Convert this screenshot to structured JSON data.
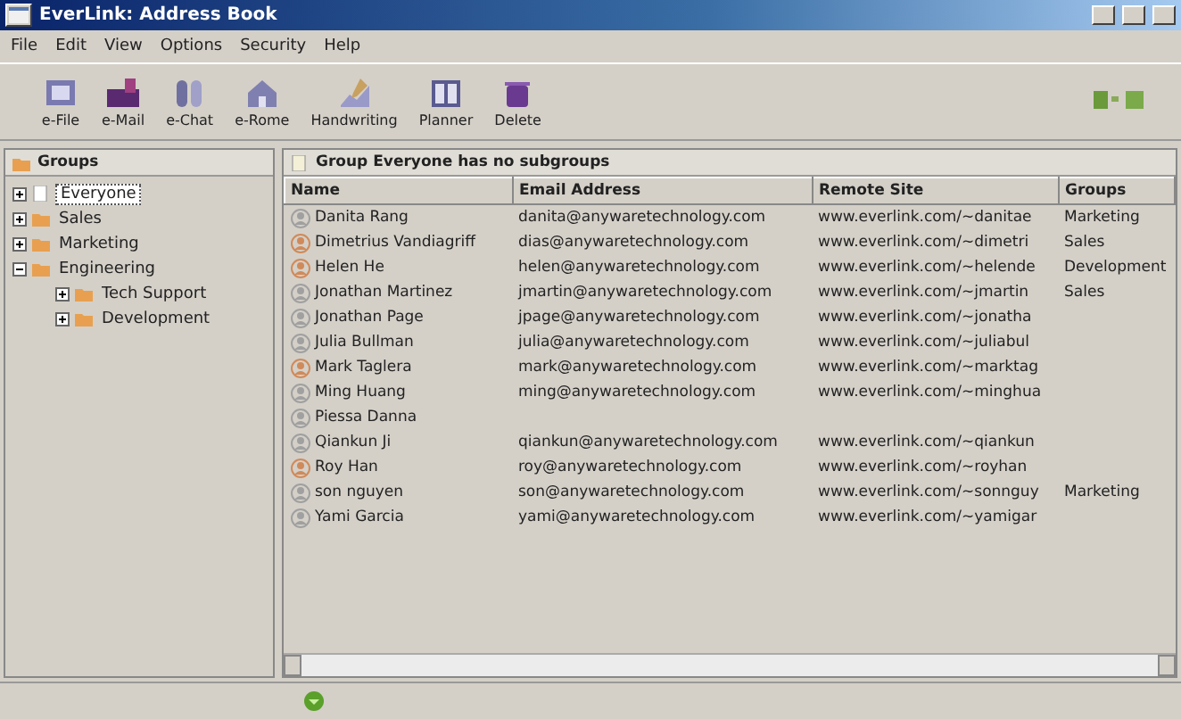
{
  "window": {
    "title": "EverLink: Address Book"
  },
  "menu": [
    "File",
    "Edit",
    "View",
    "Options",
    "Security",
    "Help"
  ],
  "toolbar": [
    {
      "label": "e-File",
      "kind": "file"
    },
    {
      "label": "e-Mail",
      "kind": "mail"
    },
    {
      "label": "e-Chat",
      "kind": "chat"
    },
    {
      "label": "e-Rome",
      "kind": "home"
    },
    {
      "label": "Handwriting",
      "kind": "pen"
    },
    {
      "label": "Planner",
      "kind": "planner"
    },
    {
      "label": "Delete",
      "kind": "trash"
    }
  ],
  "sidebar": {
    "title": "Groups",
    "items": [
      {
        "label": "Everyone",
        "selected": true,
        "expanded": false
      },
      {
        "label": "Sales",
        "selected": false,
        "expanded": false
      },
      {
        "label": "Marketing",
        "selected": false,
        "expanded": false
      },
      {
        "label": "Engineering",
        "selected": false,
        "expanded": true,
        "children": [
          {
            "label": "Tech Support",
            "selected": false,
            "expanded": false
          },
          {
            "label": "Development",
            "selected": false,
            "expanded": false
          }
        ]
      }
    ]
  },
  "table": {
    "caption": "Group Everyone has no subgroups",
    "columns": [
      "Name",
      "Email Address",
      "Remote Site",
      "Groups"
    ],
    "rows": [
      {
        "color": "#a0a0a0",
        "cells": [
          "Danita Rang",
          "danita@anywaretechnology.com",
          "www.everlink.com/~danitae",
          "Marketing"
        ]
      },
      {
        "color": "#d08a5a",
        "cells": [
          "Dimetrius Vandiagriff",
          "dias@anywaretechnology.com",
          "www.everlink.com/~dimetri",
          "Sales"
        ]
      },
      {
        "color": "#d08a5a",
        "cells": [
          "Helen He",
          "helen@anywaretechnology.com",
          "www.everlink.com/~helende",
          "Development"
        ]
      },
      {
        "color": "#a0a0a0",
        "cells": [
          "Jonathan Martinez",
          "jmartin@anywaretechnology.com",
          "www.everlink.com/~jmartin",
          "Sales"
        ]
      },
      {
        "color": "#a0a0a0",
        "cells": [
          "Jonathan Page",
          "jpage@anywaretechnology.com",
          "www.everlink.com/~jonatha",
          ""
        ]
      },
      {
        "color": "#a0a0a0",
        "cells": [
          "Julia Bullman",
          "julia@anywaretechnology.com",
          "www.everlink.com/~juliabul",
          ""
        ]
      },
      {
        "color": "#d08a5a",
        "cells": [
          "Mark Taglera",
          "mark@anywaretechnology.com",
          "www.everlink.com/~marktag",
          ""
        ]
      },
      {
        "color": "#a0a0a0",
        "cells": [
          "Ming Huang",
          "ming@anywaretechnology.com",
          "www.everlink.com/~minghua",
          ""
        ]
      },
      {
        "color": "#a0a0a0",
        "cells": [
          "Piessa Danna",
          "",
          "",
          ""
        ]
      },
      {
        "color": "#a0a0a0",
        "cells": [
          "Qiankun Ji",
          "qiankun@anywaretechnology.com",
          "www.everlink.com/~qiankun",
          ""
        ]
      },
      {
        "color": "#d08a5a",
        "cells": [
          "Roy Han",
          "roy@anywaretechnology.com",
          "www.everlink.com/~royhan",
          ""
        ]
      },
      {
        "color": "#a0a0a0",
        "cells": [
          "son nguyen",
          "son@anywaretechnology.com",
          "www.everlink.com/~sonnguy",
          "Marketing"
        ]
      },
      {
        "color": "#a0a0a0",
        "cells": [
          "Yami Garcia",
          "yami@anywaretechnology.com",
          "www.everlink.com/~yamigar",
          ""
        ]
      }
    ]
  }
}
